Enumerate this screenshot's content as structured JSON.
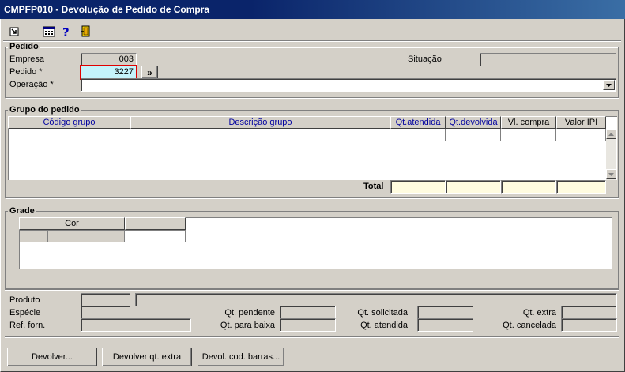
{
  "window": {
    "title": "CMPFP010 - Devolução de Pedido de Compra"
  },
  "toolbar": {
    "icons": [
      "export-icon",
      "calculator-icon",
      "help-icon",
      "exit-door-icon"
    ]
  },
  "pedido": {
    "title": "Pedido",
    "empresa_label": "Empresa",
    "empresa_value": "003",
    "pedido_label": "Pedido *",
    "pedido_value": "3227",
    "search_button": "»",
    "situacao_label": "Situação",
    "situacao_value": "",
    "operacao_label": "Operação *",
    "operacao_value": ""
  },
  "grupo": {
    "title": "Grupo do pedido",
    "columns": [
      "Código grupo",
      "Descrição grupo",
      "Qt.atendida",
      "Qt.devolvida",
      "Vl. compra",
      "Valor IPI"
    ],
    "total_label": "Total"
  },
  "grade": {
    "title": "Grade",
    "columns": [
      "Cor",
      ""
    ]
  },
  "info": {
    "produto_label": "Produto",
    "especie_label": "Espécie",
    "ref_forn_label": "Ref. forn.",
    "qt_pendente_label": "Qt. pendente",
    "qt_para_baixa_label": "Qt. para baixa",
    "qt_solicitada_label": "Qt. solicitada",
    "qt_atendida_label": "Qt. atendida",
    "qt_extra_label": "Qt. extra",
    "qt_cancelada_label": "Qt. cancelada"
  },
  "buttons": {
    "devolver": "Devolver...",
    "devolver_extra": "Devolver qt. extra",
    "devol_cod_barras": "Devol. cod. barras..."
  },
  "colors": {
    "titlebar": "#0a246a",
    "highlight_field": "#c4f3fb",
    "required_outline": "#e00000",
    "header_text": "#0000a0",
    "total_cells": "#fffce0"
  }
}
